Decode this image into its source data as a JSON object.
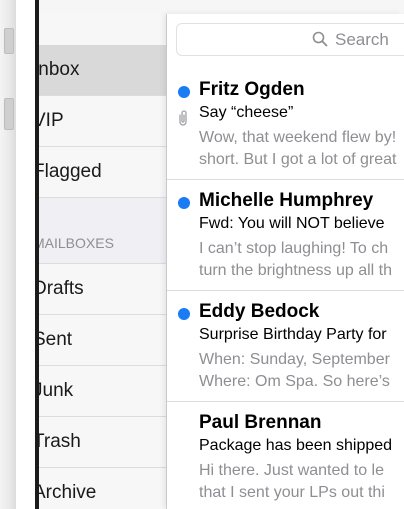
{
  "sidebar": {
    "items": [
      {
        "label": "Inbox",
        "selected": true
      },
      {
        "label": "VIP"
      },
      {
        "label": "Flagged"
      }
    ],
    "section_title": "MAILBOXES",
    "mailboxes": [
      {
        "label": "Drafts"
      },
      {
        "label": "Sent"
      },
      {
        "label": "Junk"
      },
      {
        "label": "Trash"
      },
      {
        "label": "Archive"
      }
    ]
  },
  "search": {
    "placeholder": "Search",
    "icon": "search-icon"
  },
  "messages": [
    {
      "sender": "Fritz Ogden",
      "subject": "Say “cheese”",
      "preview_line1": "Wow, that weekend flew by!",
      "preview_line2": "short. But I got a lot of great",
      "unread": true,
      "has_attachment": true
    },
    {
      "sender": "Michelle Humphrey",
      "subject": "Fwd: You will NOT believe",
      "preview_line1": "I can’t stop laughing! To ch",
      "preview_line2": "turn the brightness up all th",
      "unread": true,
      "has_attachment": false
    },
    {
      "sender": "Eddy Bedock",
      "subject": "Surprise Birthday Party for",
      "preview_line1": "When: Sunday, September",
      "preview_line2": "Where: Om Spa. So here’s",
      "unread": true,
      "has_attachment": false
    },
    {
      "sender": "Paul Brennan",
      "subject": "Package has been shipped",
      "preview_line1": "Hi there. Just wanted to le",
      "preview_line2": "that I sent your LPs out thi",
      "unread": false,
      "has_attachment": false
    }
  ],
  "colors": {
    "accent": "#1a7cf5",
    "selected_row": "#d9d9d9",
    "secondary_text": "#8e8e93"
  }
}
